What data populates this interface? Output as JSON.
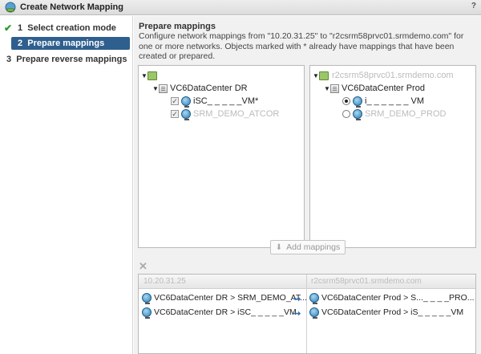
{
  "window": {
    "title": "Create Network Mapping",
    "help": "?"
  },
  "steps": [
    {
      "num": "1",
      "label": "Select creation mode",
      "done": true
    },
    {
      "num": "2",
      "label": "Prepare mappings",
      "active": true
    },
    {
      "num": "3",
      "label": "Prepare reverse mappings"
    }
  ],
  "content": {
    "heading": "Prepare mappings",
    "description": "Configure network mappings from \"10.20.31.25\" to \"r2csrm58prvc01.srmdemo.com\" for one or more networks. Objects marked with * already have mappings that have been created or prepared."
  },
  "left_tree": {
    "root_label": "",
    "datacenter": "VC6DataCenter DR",
    "networks": [
      {
        "label": "iSC_ _ _ _ _VM*",
        "checked": true
      },
      {
        "label": "SRM_DEMO_ATCOR",
        "checked": true
      }
    ]
  },
  "right_tree": {
    "root_label": "r2csrm58prvc01.srmdemo.com",
    "datacenter": "VC6DataCenter Prod",
    "networks": [
      {
        "label": "i_ _ _ _ _ _ VM",
        "selected": true
      },
      {
        "label": "SRM_DEMO_PROD",
        "selected": false
      }
    ]
  },
  "add_button": "Add mappings",
  "mappings_table": {
    "headers": [
      "10.20.31.25",
      "r2csrm58prvc01.srmdemo.com"
    ],
    "rows": [
      {
        "source": "VC6DataCenter DR > SRM_DEMO_AT...",
        "target": "VC6DataCenter Prod > S..._ _ _ _PRO..."
      },
      {
        "source": "VC6DataCenter DR > iSC_ _ _ _ _VM",
        "target": "VC6DataCenter Prod > iS_ _ _ _ _VM"
      }
    ]
  },
  "colors": {
    "active_step": "#2f5f8e",
    "check": "#2e9a2e",
    "arrow": "#2f6fae"
  }
}
